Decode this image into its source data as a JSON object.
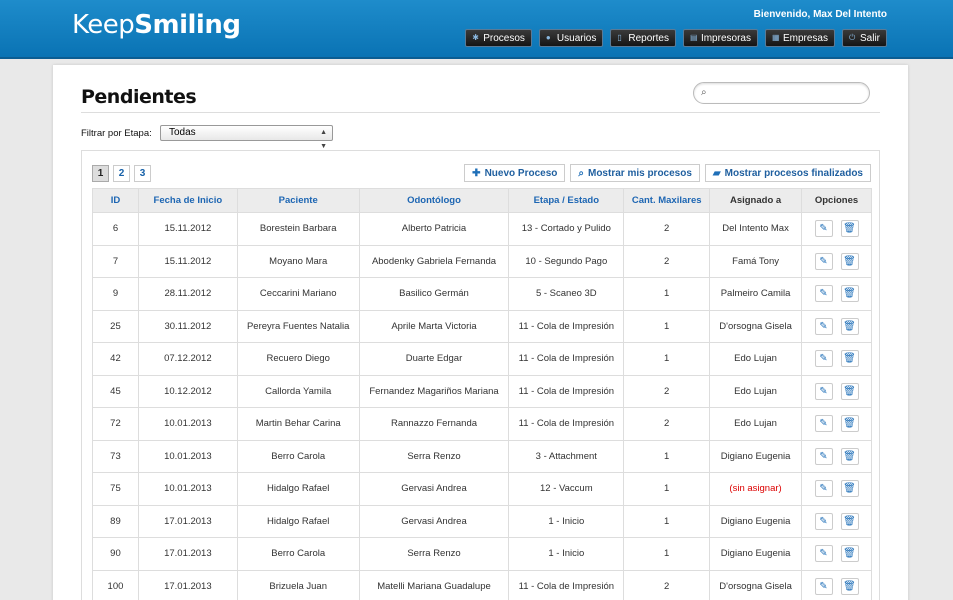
{
  "header": {
    "logo_a": "Keep",
    "logo_b": "Smiling",
    "welcome": "Bienvenido, Max Del Intento",
    "nav": [
      {
        "label": "Procesos",
        "icon": "gear-icon"
      },
      {
        "label": "Usuarios",
        "icon": "user-icon"
      },
      {
        "label": "Reportes",
        "icon": "document-icon"
      },
      {
        "label": "Impresoras",
        "icon": "printer-icon"
      },
      {
        "label": "Empresas",
        "icon": "building-icon"
      },
      {
        "label": "Salir",
        "icon": "power-icon"
      }
    ]
  },
  "page": {
    "title": "Pendientes",
    "search_placeholder": "",
    "filter_label": "Filtrar por Etapa:",
    "filter_value": "Todas"
  },
  "pager": [
    "1",
    "2",
    "3"
  ],
  "toolbar": {
    "new": "Nuevo Proceso",
    "mine": "Mostrar mis procesos",
    "done": "Mostrar procesos finalizados"
  },
  "table": {
    "headers": [
      "ID",
      "Fecha de Inicio",
      "Paciente",
      "Odontólogo",
      "Etapa / Estado",
      "Cant. Maxilares",
      "Asignado a",
      "Opciones"
    ],
    "rows": [
      [
        "6",
        "15.11.2012",
        "Borestein Barbara",
        "Alberto Patricia",
        "13 - Cortado y Pulido",
        "2",
        "Del Intento Max"
      ],
      [
        "7",
        "15.11.2012",
        "Moyano Mara",
        "Abodenky Gabriela Fernanda",
        "10 - Segundo Pago",
        "2",
        "Famá Tony"
      ],
      [
        "9",
        "28.11.2012",
        "Ceccarini Mariano",
        "Basilico Germán",
        "5 - Scaneo 3D",
        "1",
        "Palmeiro Camila"
      ],
      [
        "25",
        "30.11.2012",
        "Pereyra Fuentes Natalia",
        "Aprile Marta Victoria",
        "11 - Cola de Impresión",
        "1",
        "D'orsogna Gisela"
      ],
      [
        "42",
        "07.12.2012",
        "Recuero Diego",
        "Duarte Edgar",
        "11 - Cola de Impresión",
        "1",
        "Edo Lujan"
      ],
      [
        "45",
        "10.12.2012",
        "Callorda Yamila",
        "Fernandez Magariños Mariana",
        "11 - Cola de Impresión",
        "2",
        "Edo Lujan"
      ],
      [
        "72",
        "10.01.2013",
        "Martin Behar Carina",
        "Rannazzo Fernanda",
        "11 - Cola de Impresión",
        "2",
        "Edo Lujan"
      ],
      [
        "73",
        "10.01.2013",
        "Berro Carola",
        "Serra Renzo",
        "3 - Attachment",
        "1",
        "Digiano Eugenia"
      ],
      [
        "75",
        "10.01.2013",
        "Hidalgo Rafael",
        "Gervasi Andrea",
        "12 - Vaccum",
        "1",
        "(sin asignar)"
      ],
      [
        "89",
        "17.01.2013",
        "Hidalgo Rafael",
        "Gervasi Andrea",
        "1 - Inicio",
        "1",
        "Digiano Eugenia"
      ],
      [
        "90",
        "17.01.2013",
        "Berro Carola",
        "Serra Renzo",
        "1 - Inicio",
        "1",
        "Digiano Eugenia"
      ],
      [
        "100",
        "17.01.2013",
        "Brizuela Juan",
        "Matelli Mariana Guadalupe",
        "11 - Cola de Impresión",
        "2",
        "D'orsogna Gisela"
      ]
    ]
  }
}
